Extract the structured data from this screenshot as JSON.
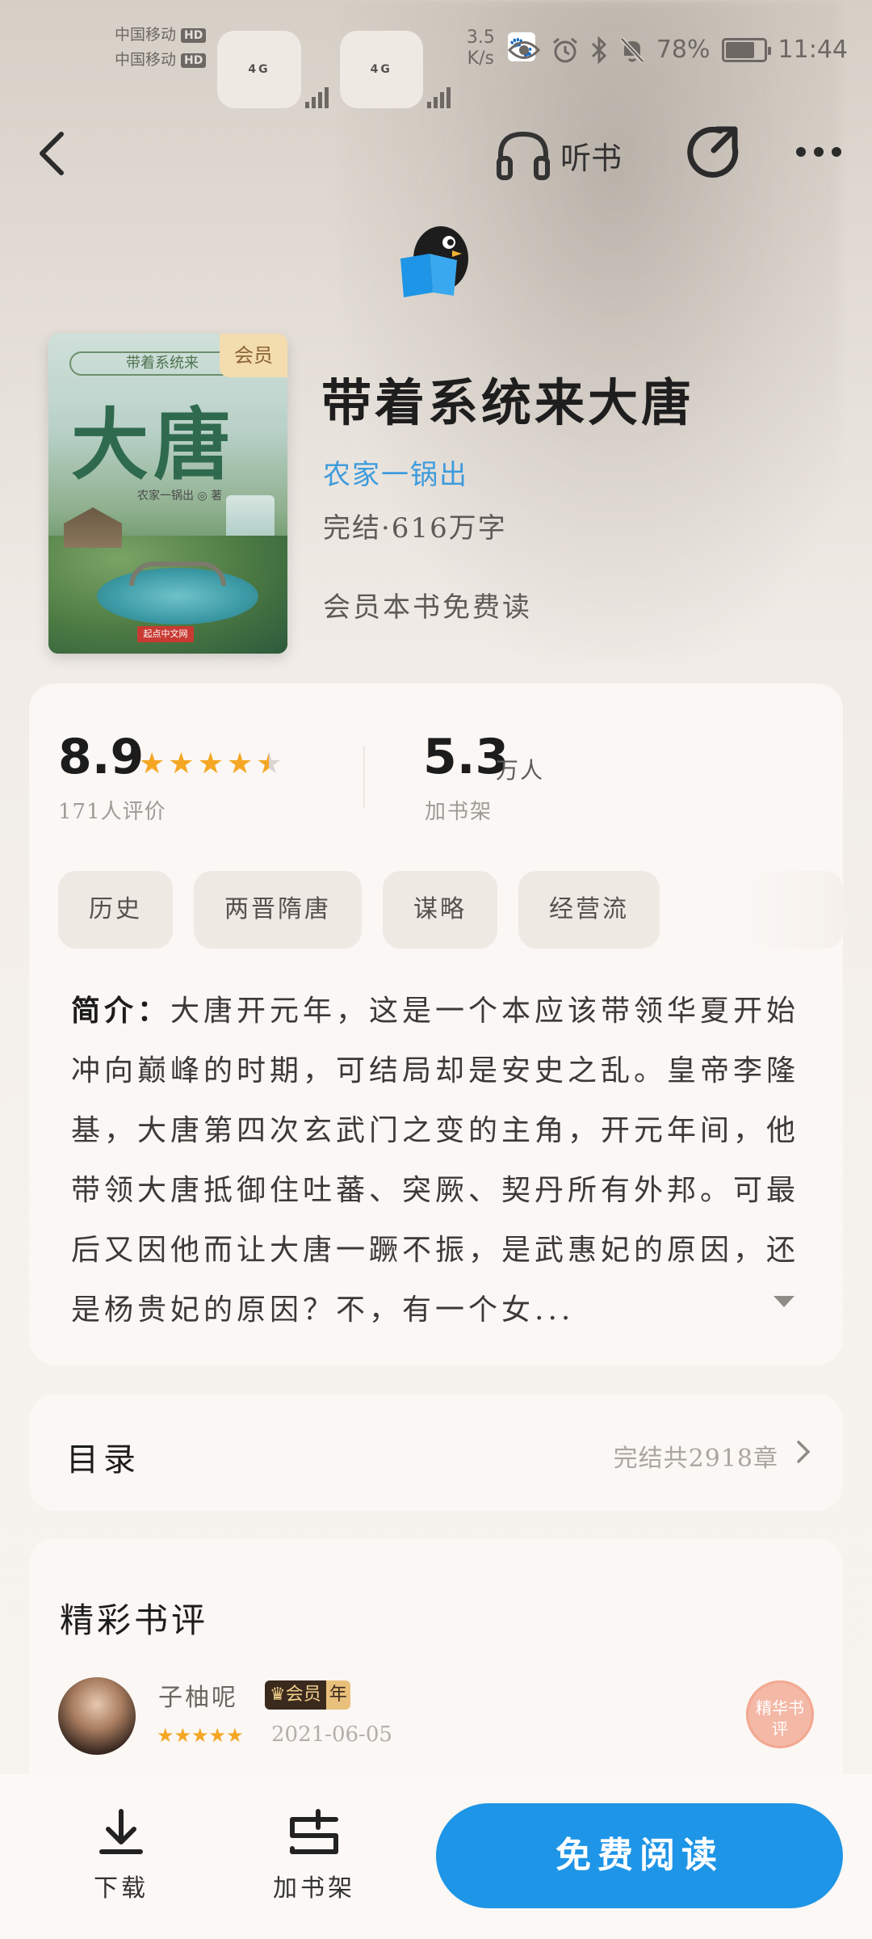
{
  "status_bar": {
    "carrier1": "中国移动",
    "carrier2": "中国移动",
    "hd": "HD",
    "net_type": "4G",
    "net_speed_value": "3.5",
    "net_speed_unit": "K/s",
    "battery": "78%",
    "time": "11:44"
  },
  "nav": {
    "listen_label": "听书"
  },
  "book": {
    "cover_badge": "会员",
    "cover_title": "大唐",
    "cover_subtitle": "带着系统来",
    "cover_author": "农家一锅出 ◎ 著",
    "cover_publisher": "起点中文网",
    "title": "带着系统来大唐",
    "author": "农家一锅出",
    "status": "完结·616万字",
    "vip_free": "会员本书免费读"
  },
  "stats": {
    "score": "8.9",
    "star_rating": 4.5,
    "rating_count": "171人评价",
    "shelf_count": "5.3",
    "shelf_unit": "万人",
    "shelf_label": "加书架"
  },
  "tags": [
    "历史",
    "两晋隋唐",
    "谋略",
    "经营流"
  ],
  "intro": {
    "label": "简介：",
    "text": "大唐开元年，这是一个本应该带领华夏开始冲向巅峰的时期，可结局却是安史之乱。皇帝李隆基，大唐第四次玄武门之变的主角，开元年间，他带领大唐抵御住吐蕃、突厥、契丹所有外邦。可最后又因他而让大唐一蹶不振，是武惠妃的原因，还是杨贵妃的原因？不，有一个女..."
  },
  "toc": {
    "label": "目录",
    "meta": "完结共2918章"
  },
  "reviews": {
    "header": "精彩书评",
    "items": [
      {
        "name": "子柚呢",
        "badge_main": "♛会员",
        "badge_sub": "年",
        "stars": "★★★★★",
        "date": "2021-06-05",
        "stamp": "精华书评"
      }
    ]
  },
  "bottom": {
    "download": "下载",
    "add_shelf": "加书架",
    "read": "免费阅读"
  },
  "colors": {
    "accent_blue": "#1e95e6",
    "author_blue": "#3c9bdc",
    "star": "#f5a623"
  }
}
